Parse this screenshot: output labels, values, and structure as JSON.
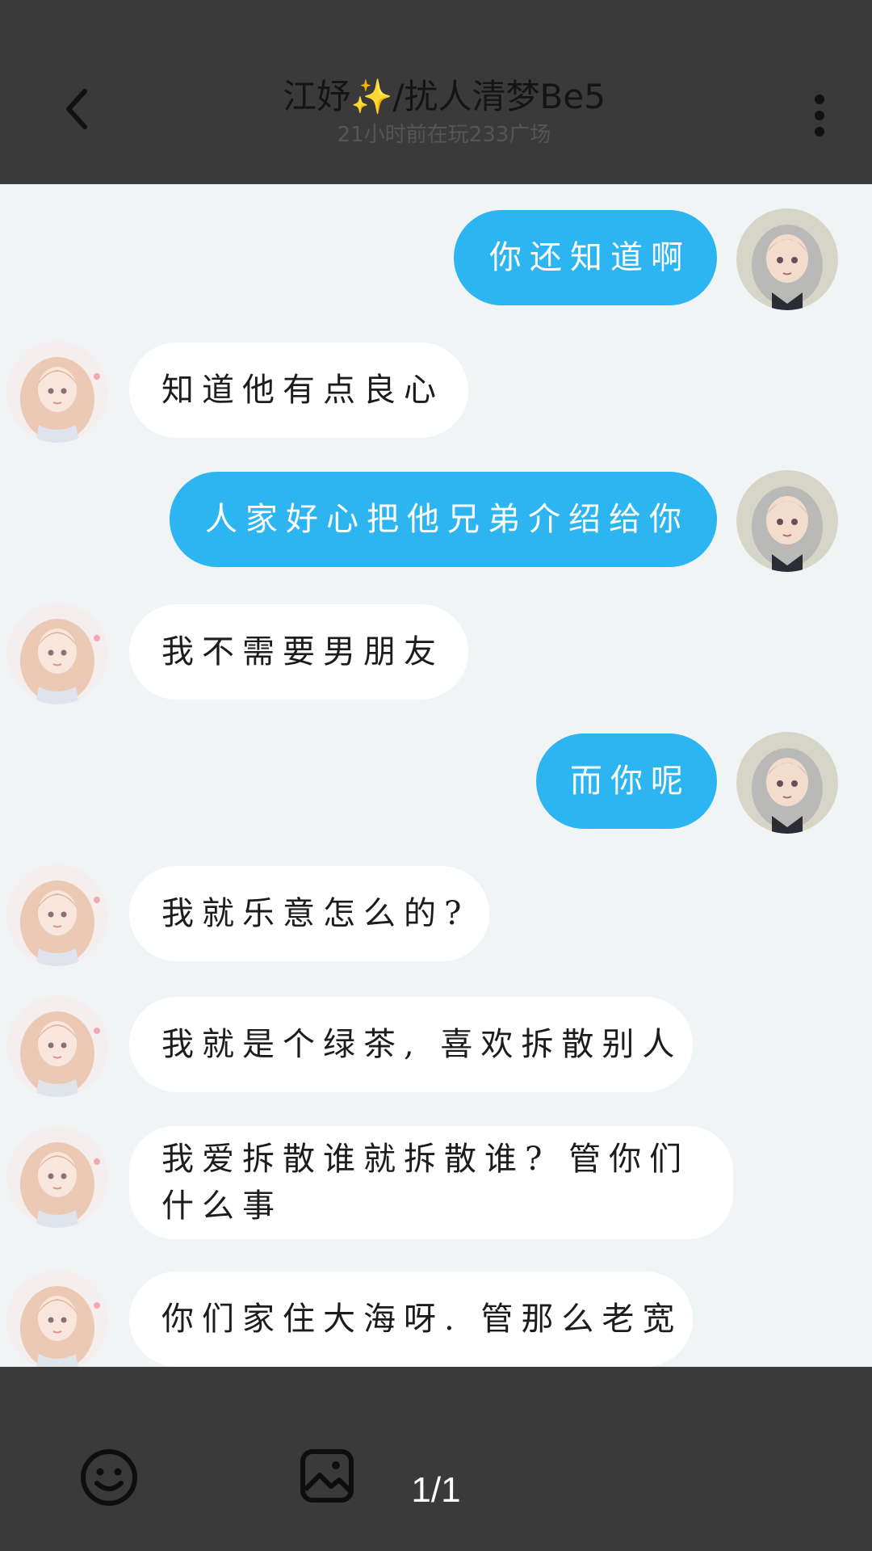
{
  "header": {
    "title_name": "江妤",
    "title_sparkle": "✨",
    "title_rest": "/扰人清梦Be5",
    "subtitle": "21小时前在玩233广场",
    "back_icon": "chevron-left-icon",
    "more_icon": "more-vertical-icon"
  },
  "messages": [
    {
      "side": "sent",
      "text": "你还知道啊"
    },
    {
      "side": "received",
      "text": "知道他有点良心"
    },
    {
      "side": "sent",
      "text": "人家好心把他兄弟介绍给你"
    },
    {
      "side": "received",
      "text": "我不需要男朋友"
    },
    {
      "side": "sent",
      "text": "而你呢"
    },
    {
      "side": "received",
      "text": "我就乐意怎么的?"
    },
    {
      "side": "received",
      "text": "我就是个绿茶, 喜欢拆散别人"
    },
    {
      "side": "received",
      "text": "我爱拆散谁就拆散谁? 管你们什么事"
    },
    {
      "side": "received",
      "text": "你们家住大海呀. 管那么老宽"
    }
  ],
  "bottom": {
    "emoji_icon": "smiley-icon",
    "image_icon": "image-icon",
    "page_indicator": "1/1"
  },
  "colors": {
    "background": "#3a3a3a",
    "chat_bg": "#f1f4f5",
    "sent_bubble": "#2db5f1",
    "received_bubble": "#ffffff"
  }
}
